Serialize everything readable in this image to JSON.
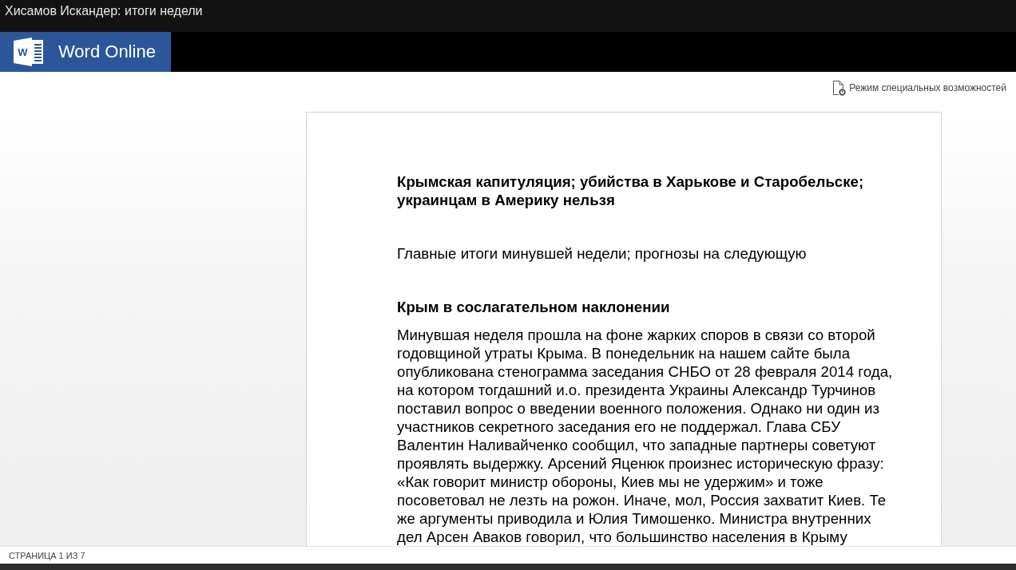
{
  "window": {
    "title": "Хисамов Искандер: итоги недели"
  },
  "app_bar": {
    "logo_letter": "W",
    "brand": "Word Online"
  },
  "toolbar": {
    "accessibility_button": "Режим специальных возможностей"
  },
  "document": {
    "blocks": [
      {
        "kind": "title",
        "text": "Крымская капитуляция; убийства в Харькове и Старобельске; украинцам в Америку нельзя"
      },
      {
        "kind": "subtitle",
        "text": "Главные итоги минувшей недели; прогнозы на следующую"
      },
      {
        "kind": "heading",
        "text": "Крым в сослагательном наклонении"
      },
      {
        "kind": "paragraph",
        "text": "Минувшая неделя прошла на фоне жарких споров в связи со второй годовщиной утраты Крыма. В понедельник на нашем сайте была опубликована стенограмма заседания СНБО от 28 февраля 2014 года, на котором тогдашний и.о. президента Украины Александр Турчинов поставил вопрос о введении военного положения. Однако ни один из участников секретного заседания его не поддержал. Глава СБУ Валентин Наливайченко сообщил, что западные партнеры советуют проявлять выдержку. Арсений Яценюк произнес историческую фразу: «Как говорит министр обороны, Киев мы не удержим» и тоже посоветовал не лезть на рожон. Иначе, мол, Россия захватит Киев. Те же аргументы приводила и Юлия Тимошенко. Министра внутренних дел Арсен Аваков говорил, что большинство населения в Крыму"
      }
    ]
  },
  "status_bar": {
    "page_indicator": "СТРАНИЦА 1 ИЗ 7"
  }
}
